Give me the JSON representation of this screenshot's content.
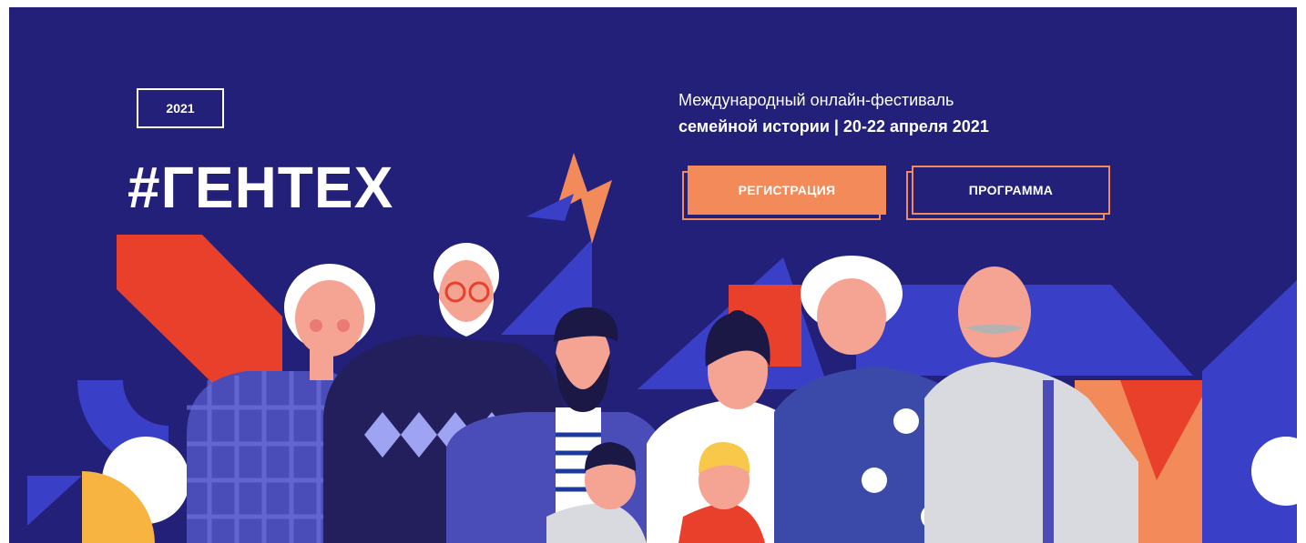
{
  "festival": {
    "year_badge": "2021",
    "logo_text": "#ГЕНТЕХ",
    "subtitle_line1": "Международный онлайн-фестиваль",
    "subtitle_line2": "семейной истории | 20-22 апреля 2021"
  },
  "buttons": {
    "register_label": "РЕГИСТРАЦИЯ",
    "program_label": "ПРОГРАММА"
  },
  "colors": {
    "background": "#23207a",
    "accent_orange": "#f28a5a",
    "accent_red": "#e8402a",
    "accent_blue": "#3a3fc8"
  },
  "illustration": {
    "subject": "family-group-illustration"
  }
}
